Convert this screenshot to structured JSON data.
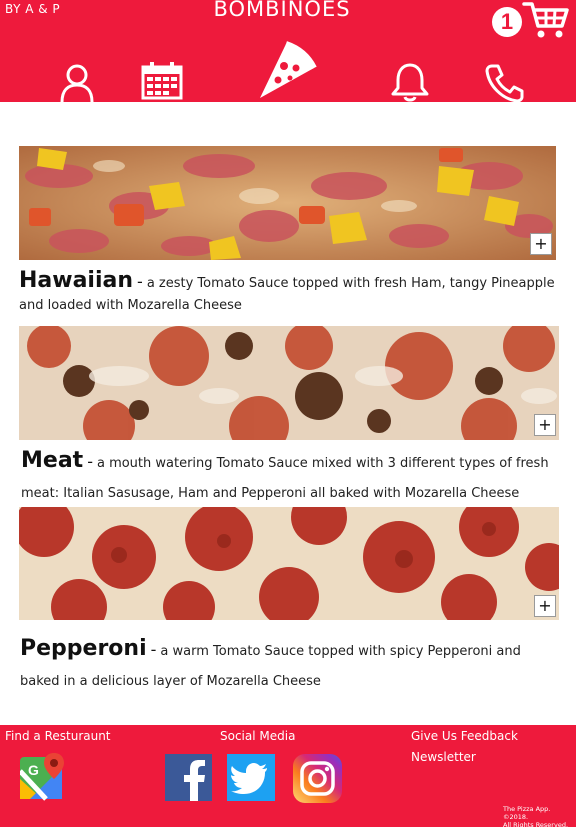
{
  "header": {
    "by_line": "BY A & P",
    "title": "BOMBINOES",
    "cart_count": "1",
    "nav": [
      "user-icon",
      "calendar-icon",
      "pizza-icon",
      "bell-icon",
      "phone-icon"
    ]
  },
  "menu": {
    "add_label": "+",
    "items": [
      {
        "name": "Hawaiian",
        "dash": "-",
        "description": "a zesty Tomato Sauce topped with fresh Ham, tangy Pineapple and loaded with Mozarella Cheese"
      },
      {
        "name": "Meat",
        "dash": "-",
        "description": "a mouth watering Tomato Sauce mixed with 3 different types of fresh meat: Italian Sasusage, Ham and Pepperoni all baked with Mozarella Cheese"
      },
      {
        "name": "Pepperoni",
        "dash": "-",
        "description": "a warm Tomato Sauce topped with spicy Pepperoni and baked in a delicious layer of Mozarella Cheese"
      }
    ]
  },
  "footer": {
    "find": "Find a Resturaunt",
    "social": "Social Media",
    "feedback": "Give Us Feedback",
    "newsletter": "Newsletter",
    "copyright_1": "The Pizza App. ©2018.",
    "copyright_2": "All Rights Reserved.",
    "icons": [
      "google-maps-icon",
      "facebook-icon",
      "twitter-icon",
      "instagram-icon"
    ]
  },
  "colors": {
    "brand_red": "#ee1a3c",
    "white": "#ffffff"
  }
}
